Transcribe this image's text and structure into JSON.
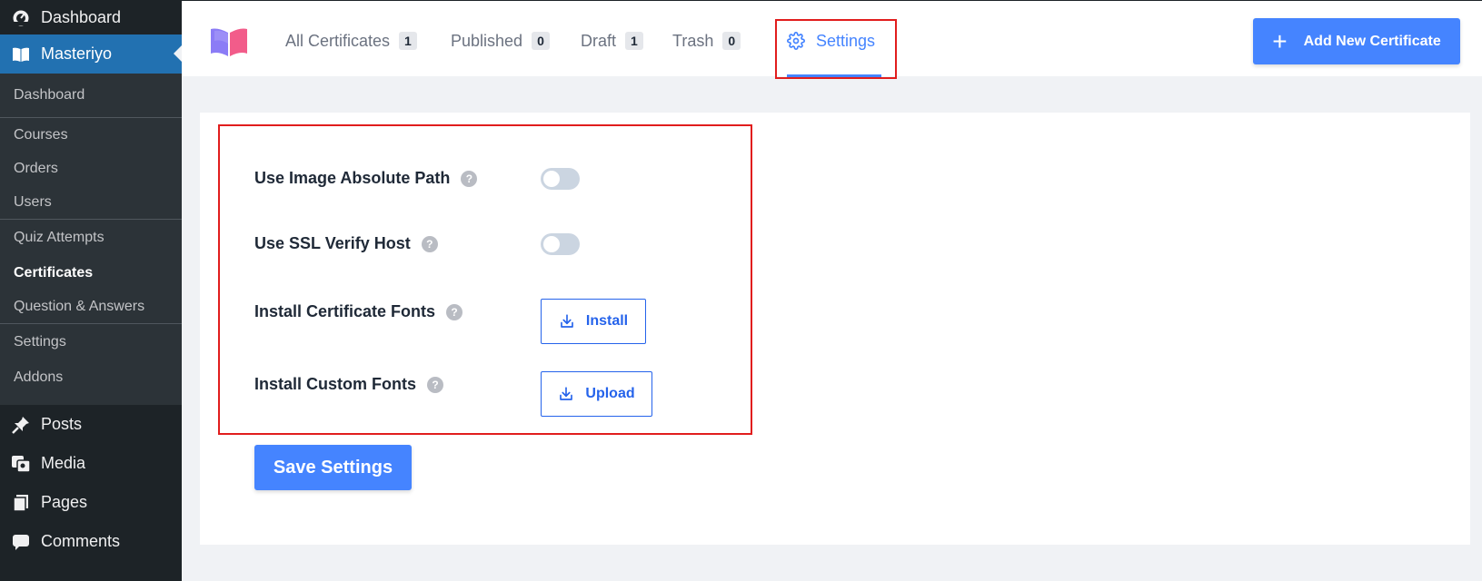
{
  "sidebar": {
    "top_item": {
      "label": "Dashboard",
      "icon": "dashboard-icon"
    },
    "active_item": {
      "label": "Masteriyo",
      "icon": "book-icon"
    },
    "submenu": [
      {
        "label": "Dashboard"
      },
      {
        "label": "Courses"
      },
      {
        "label": "Orders"
      },
      {
        "label": "Users"
      },
      {
        "label": "Quiz Attempts"
      },
      {
        "label": "Certificates",
        "current": true
      },
      {
        "label": "Question & Answers"
      },
      {
        "label": "Settings"
      },
      {
        "label": "Addons"
      }
    ],
    "main_items": [
      {
        "label": "Posts",
        "icon": "pin-icon"
      },
      {
        "label": "Media",
        "icon": "media-icon"
      },
      {
        "label": "Pages",
        "icon": "pages-icon"
      },
      {
        "label": "Comments",
        "icon": "comment-icon"
      }
    ]
  },
  "header": {
    "tabs": [
      {
        "label": "All Certificates",
        "count": "1"
      },
      {
        "label": "Published",
        "count": "0"
      },
      {
        "label": "Draft",
        "count": "1"
      },
      {
        "label": "Trash",
        "count": "0"
      },
      {
        "label": "Settings",
        "active": true,
        "icon": "gear-icon"
      }
    ],
    "add_button": {
      "label": "Add New Certificate",
      "icon": "plus-icon"
    }
  },
  "settings": {
    "rows": [
      {
        "label": "Use Image Absolute Path",
        "control": "toggle",
        "enabled": false
      },
      {
        "label": "Use SSL Verify Host",
        "control": "toggle",
        "enabled": false
      },
      {
        "label": "Install Certificate Fonts",
        "control": "button",
        "button_label": "Install"
      },
      {
        "label": "Install Custom Fonts",
        "control": "button",
        "button_label": "Upload"
      }
    ],
    "help_glyph": "?",
    "save_label": "Save Settings"
  },
  "colors": {
    "accent": "#4584ff",
    "sidebar_bg": "#1d2327",
    "sidebar_active": "#2271b1",
    "highlight": "#e11d1d"
  }
}
